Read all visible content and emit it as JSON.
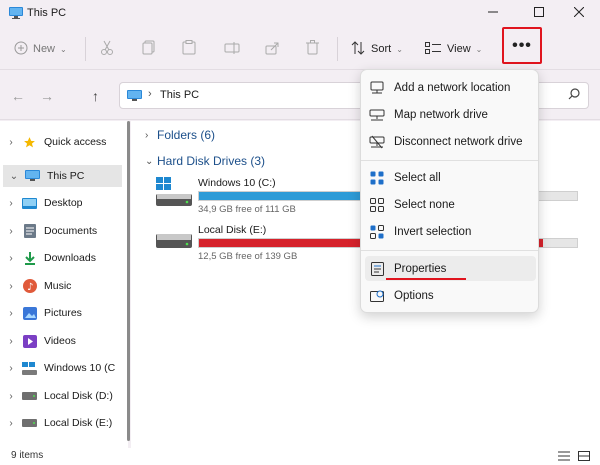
{
  "window": {
    "title": "This PC",
    "controls": {
      "minimize": "minimize-icon",
      "maximize": "maximize-icon",
      "close": "close-icon"
    }
  },
  "toolbar": {
    "new_label": "New",
    "sort_label": "Sort",
    "view_label": "View",
    "more_label": "•••"
  },
  "navigation": {
    "back": "←",
    "forward": "→",
    "up": "↑",
    "address_path": "This PC"
  },
  "sidebar": {
    "items": [
      {
        "label": "Quick access",
        "icon": "star-icon",
        "expander": "›"
      },
      {
        "label": "This PC",
        "icon": "computer-icon",
        "expander": "⌄",
        "selected": true
      },
      {
        "label": "Desktop",
        "icon": "desktop-folder-icon",
        "expander": "›"
      },
      {
        "label": "Documents",
        "icon": "documents-folder-icon",
        "expander": "›"
      },
      {
        "label": "Downloads",
        "icon": "downloads-folder-icon",
        "expander": "›"
      },
      {
        "label": "Music",
        "icon": "music-folder-icon",
        "expander": "›"
      },
      {
        "label": "Pictures",
        "icon": "pictures-folder-icon",
        "expander": "›"
      },
      {
        "label": "Videos",
        "icon": "videos-folder-icon",
        "expander": "›"
      },
      {
        "label": "Windows 10 (C",
        "icon": "windows-drive-icon",
        "expander": "›"
      },
      {
        "label": "Local Disk (D:)",
        "icon": "drive-icon",
        "expander": "›"
      },
      {
        "label": "Local Disk (E:)",
        "icon": "drive-icon",
        "expander": "›"
      }
    ]
  },
  "content": {
    "folders_header": "Folders (6)",
    "drives_header": "Hard Disk Drives (3)",
    "drives": [
      {
        "name": "Windows 10 (C:)",
        "free_text": "34,9 GB free of 111 GB",
        "used_fraction": 0.69,
        "color": "#2d9bd7"
      },
      {
        "name": "Local Disk (E:)",
        "free_text": "12,5 GB free of 139 GB",
        "used_fraction": 0.91,
        "color": "#d6222b"
      }
    ]
  },
  "context_menu": {
    "items": [
      {
        "label": "Add a network location",
        "icon": "network-location-icon"
      },
      {
        "label": "Map network drive",
        "icon": "map-drive-icon"
      },
      {
        "label": "Disconnect network drive",
        "icon": "disconnect-drive-icon"
      },
      {
        "label": "Select all",
        "icon": "select-all-icon"
      },
      {
        "label": "Select none",
        "icon": "select-none-icon"
      },
      {
        "label": "Invert selection",
        "icon": "invert-selection-icon"
      },
      {
        "label": "Properties",
        "icon": "properties-icon",
        "highlighted": true
      },
      {
        "label": "Options",
        "icon": "options-icon"
      }
    ]
  },
  "status": {
    "item_count": "9 items"
  },
  "colors": {
    "accent_red": "#e0141e",
    "drive_blue": "#2d9bd7",
    "drive_red": "#d6222b",
    "header_blue": "#1c4f8a"
  }
}
